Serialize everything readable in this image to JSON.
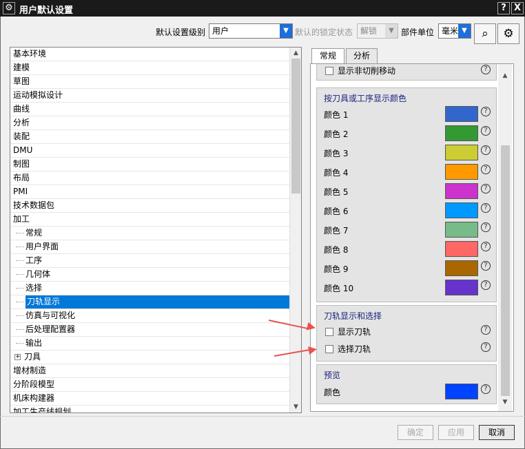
{
  "window": {
    "title": "用户默认设置",
    "help_label": "?",
    "close_label": "X"
  },
  "toolbar": {
    "level_label": "默认设置级别",
    "level_value": "用户",
    "lock_label": "默认的锁定状态",
    "lock_value": "解锁",
    "unit_label": "部件单位",
    "unit_value": "毫米"
  },
  "tree": {
    "items": [
      {
        "label": "基本环境",
        "child": false
      },
      {
        "label": "建模",
        "child": false
      },
      {
        "label": "草图",
        "child": false
      },
      {
        "label": "运动模拟设计",
        "child": false
      },
      {
        "label": "曲线",
        "child": false
      },
      {
        "label": "分析",
        "child": false
      },
      {
        "label": "装配",
        "child": false
      },
      {
        "label": "DMU",
        "child": false
      },
      {
        "label": "制图",
        "child": false
      },
      {
        "label": "布局",
        "child": false
      },
      {
        "label": "PMI",
        "child": false
      },
      {
        "label": "技术数据包",
        "child": false
      },
      {
        "label": "加工",
        "child": false
      },
      {
        "label": "常规",
        "child": true
      },
      {
        "label": "用户界面",
        "child": true
      },
      {
        "label": "工序",
        "child": true
      },
      {
        "label": "几何体",
        "child": true
      },
      {
        "label": "选择",
        "child": true
      },
      {
        "label": "刀轨显示",
        "child": true,
        "selected": true
      },
      {
        "label": "仿真与可视化",
        "child": true
      },
      {
        "label": "后处理配置器",
        "child": true
      },
      {
        "label": "输出",
        "child": true
      },
      {
        "label": "刀具",
        "child": true,
        "expander": "+"
      },
      {
        "label": "增材制造",
        "child": false
      },
      {
        "label": "分阶段模型",
        "child": false
      },
      {
        "label": "机床构建器",
        "child": false
      },
      {
        "label": "加工生产线规划",
        "child": false
      }
    ]
  },
  "tabs": [
    "常规",
    "分析"
  ],
  "panel": {
    "top_item": "显示非切削移动",
    "color_group": {
      "title": "按刀具或工序显示颜色",
      "colors": [
        {
          "label": "颜色 1",
          "color": "#3366cc"
        },
        {
          "label": "颜色 2",
          "color": "#339933"
        },
        {
          "label": "颜色 3",
          "color": "#cccc33"
        },
        {
          "label": "颜色 4",
          "color": "#ff9900"
        },
        {
          "label": "颜色 5",
          "color": "#cc33cc"
        },
        {
          "label": "颜色 6",
          "color": "#0099ff"
        },
        {
          "label": "颜色 7",
          "color": "#77bb88"
        },
        {
          "label": "颜色 8",
          "color": "#ff6666"
        },
        {
          "label": "颜色 9",
          "color": "#aa6600"
        },
        {
          "label": "颜色 10",
          "color": "#6633cc"
        }
      ]
    },
    "toolpath_group": {
      "title": "刀轨显示和选择",
      "options": [
        "显示刀轨",
        "选择刀轨"
      ]
    },
    "preview_group": {
      "title": "预览",
      "color_label": "颜色",
      "color": "#0044ff"
    }
  },
  "buttons": {
    "ok": "确定",
    "apply": "应用",
    "cancel": "取消"
  },
  "help_glyph": "?"
}
